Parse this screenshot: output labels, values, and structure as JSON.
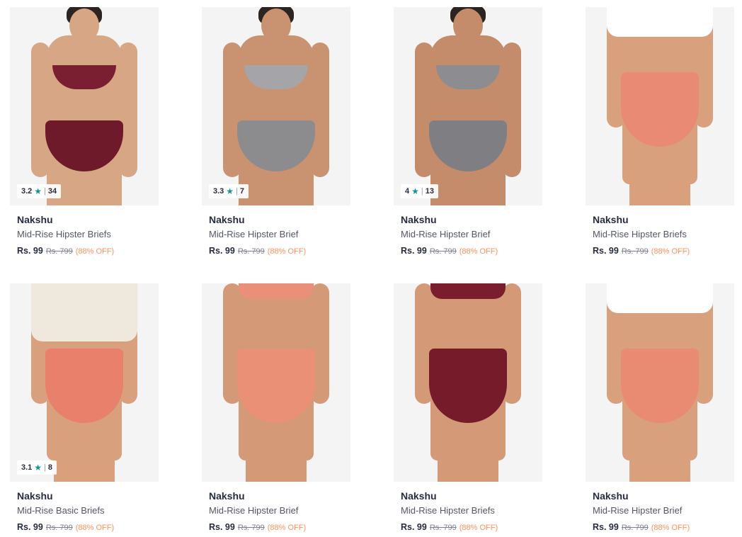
{
  "products": [
    {
      "brand": "Nakshu",
      "title": "Mid-Rise Hipster Briefs",
      "price": "Rs. 99",
      "mrp": "Rs. 799",
      "discount": "(88% OFF)",
      "rating": "3.2",
      "rating_count": "34",
      "colors": {
        "brief": "#6e1a2b",
        "top": "#7a1f31",
        "skin": "#d6a685"
      }
    },
    {
      "brand": "Nakshu",
      "title": "Mid-Rise Hipster Brief",
      "price": "Rs. 99",
      "mrp": "Rs. 799",
      "discount": "(88% OFF)",
      "rating": "3.3",
      "rating_count": "7",
      "colors": {
        "brief": "#8c8c8e",
        "top": "#a5a5a8",
        "skin": "#c99372"
      }
    },
    {
      "brand": "Nakshu",
      "title": "Mid-Rise Hipster Brief",
      "price": "Rs. 99",
      "mrp": "Rs. 799",
      "discount": "(88% OFF)",
      "rating": "4",
      "rating_count": "13",
      "colors": {
        "brief": "#7f7f83",
        "top": "#8d8d91",
        "skin": "#c48c6b"
      }
    },
    {
      "brand": "Nakshu",
      "title": "Mid-Rise Hipster Briefs",
      "price": "Rs. 99",
      "mrp": "Rs. 799",
      "discount": "(88% OFF)",
      "rating": "",
      "rating_count": "",
      "colors": {
        "brief": "#e88a74",
        "top": "#ffffff",
        "skin": "#d9a07e"
      }
    },
    {
      "brand": "Nakshu",
      "title": "Mid-Rise Basic Briefs",
      "price": "Rs. 99",
      "mrp": "Rs. 799",
      "discount": "(88% OFF)",
      "rating": "3.1",
      "rating_count": "8",
      "colors": {
        "brief": "#e9806b",
        "top": "#efe9dd",
        "skin": "#d9a07e"
      }
    },
    {
      "brand": "Nakshu",
      "title": "Mid-Rise Hipster Brief",
      "price": "Rs. 99",
      "mrp": "Rs. 799",
      "discount": "(88% OFF)",
      "rating": "",
      "rating_count": "",
      "colors": {
        "brief": "#ea9077",
        "top": "#e9907a",
        "skin": "#d49a77"
      }
    },
    {
      "brand": "Nakshu",
      "title": "Mid-Rise Hipster Briefs",
      "price": "Rs. 99",
      "mrp": "Rs. 799",
      "discount": "(88% OFF)",
      "rating": "",
      "rating_count": "",
      "colors": {
        "brief": "#761b2a",
        "top": "#7a1d2d",
        "skin": "#d49a77"
      }
    },
    {
      "brand": "Nakshu",
      "title": "Mid-Rise Hipster Brief",
      "price": "Rs. 99",
      "mrp": "Rs. 799",
      "discount": "(88% OFF)",
      "rating": "",
      "rating_count": "",
      "colors": {
        "brief": "#e98a72",
        "top": "#ffffff",
        "skin": "#d9a07e"
      }
    }
  ],
  "accent": {
    "star": "#14958f",
    "discount": "#ff905a"
  }
}
